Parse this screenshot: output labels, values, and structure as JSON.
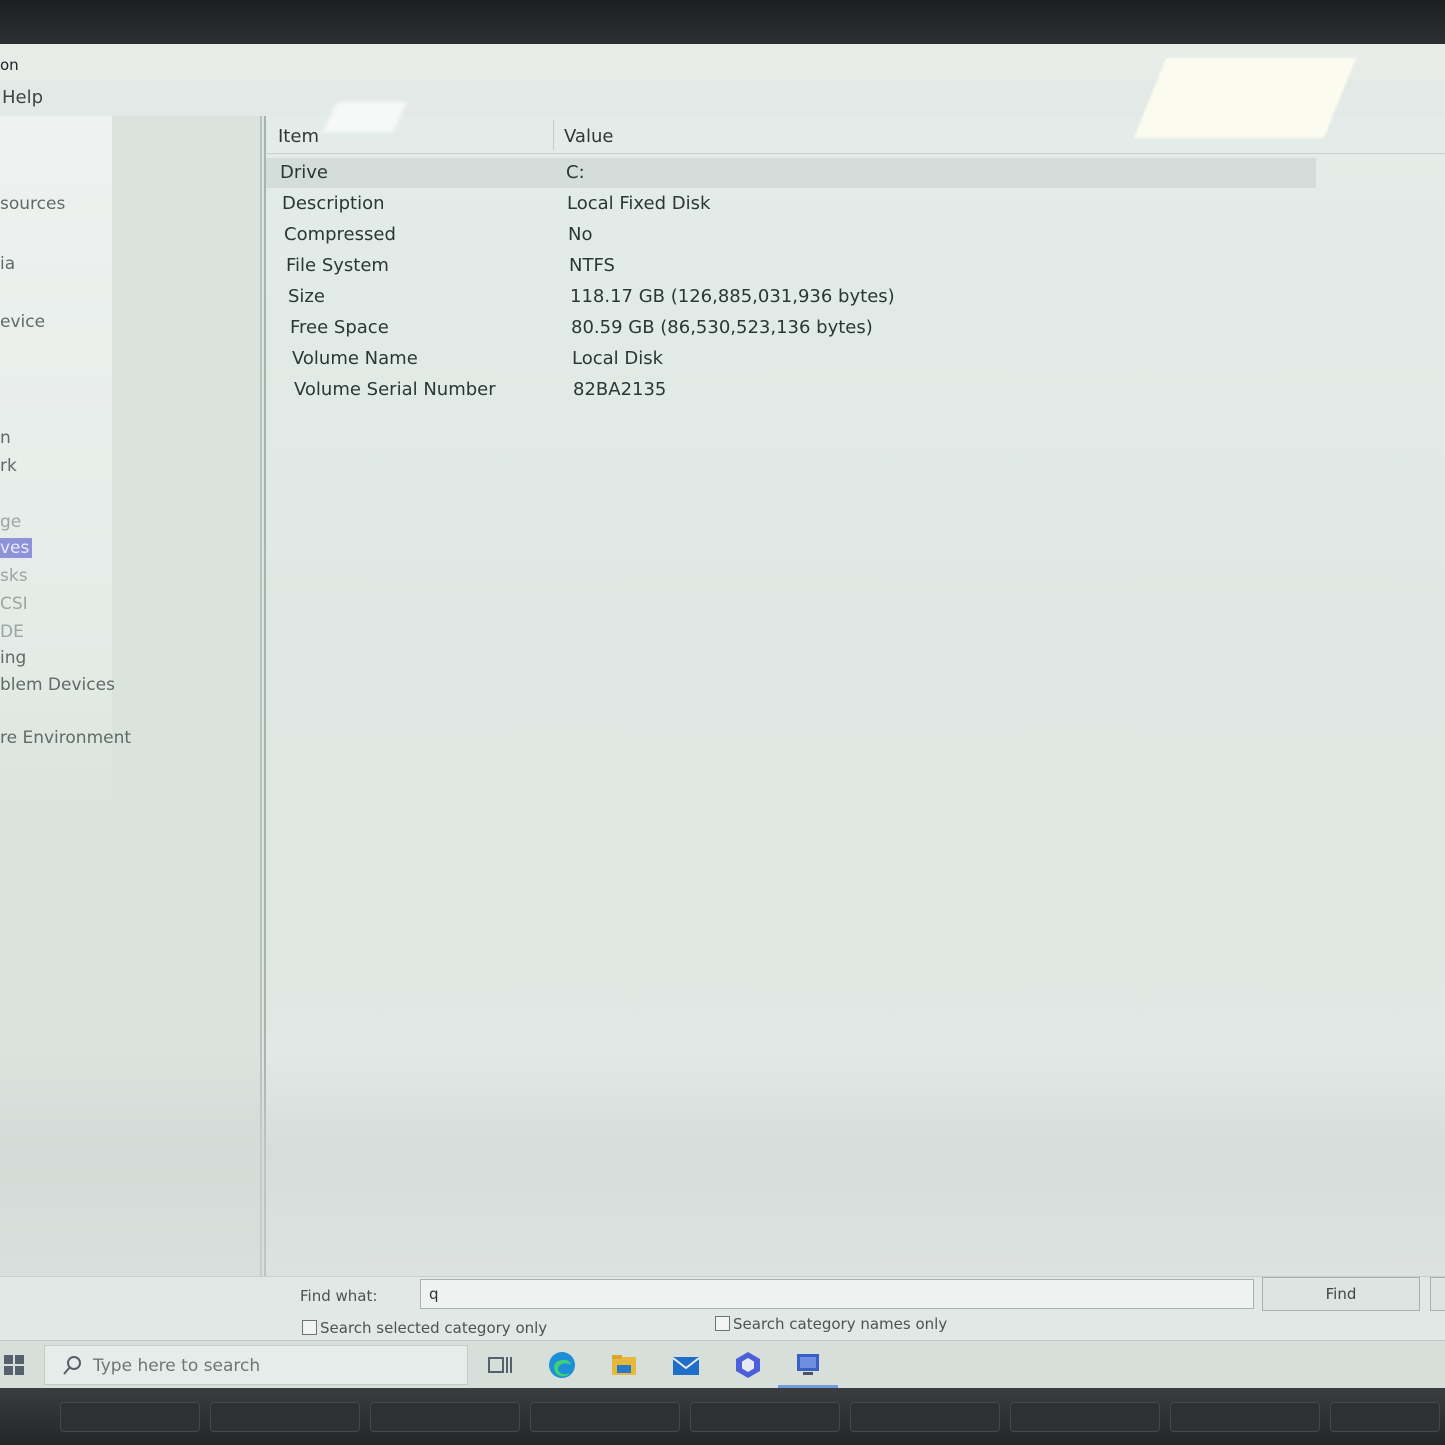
{
  "window": {
    "title_fragment": "on",
    "menu_help": "Help"
  },
  "tree": {
    "items": [
      {
        "label": "sources",
        "state": "normal"
      },
      {
        "label": "ia",
        "state": "normal"
      },
      {
        "label": "evice",
        "state": "normal"
      },
      {
        "label": "n",
        "state": "normal"
      },
      {
        "label": "rk",
        "state": "normal"
      },
      {
        "label": "ge",
        "state": "dim"
      },
      {
        "label": "ves",
        "state": "selected"
      },
      {
        "label": "sks",
        "state": "dim"
      },
      {
        "label": "CSI",
        "state": "dim"
      },
      {
        "label": "DE",
        "state": "dim"
      },
      {
        "label": "ing",
        "state": "normal"
      },
      {
        "label": "blem Devices",
        "state": "normal"
      },
      {
        "label": "re Environment",
        "state": "normal"
      }
    ]
  },
  "detail": {
    "columns": [
      "Item",
      "Value"
    ],
    "rows": [
      {
        "item": "Drive",
        "value": "C:"
      },
      {
        "item": "Description",
        "value": "Local Fixed Disk"
      },
      {
        "item": "Compressed",
        "value": "No"
      },
      {
        "item": "File System",
        "value": "NTFS"
      },
      {
        "item": "Size",
        "value": "118.17 GB (126,885,031,936 bytes)"
      },
      {
        "item": "Free Space",
        "value": "80.59 GB (86,530,523,136 bytes)"
      },
      {
        "item": "Volume Name",
        "value": "Local Disk"
      },
      {
        "item": "Volume Serial Number",
        "value": "82BA2135"
      }
    ]
  },
  "findbar": {
    "label": "Find what:",
    "value": "q",
    "find_button": "Find",
    "search_selected": "Search selected category only",
    "search_names": "Search category names only"
  },
  "taskbar": {
    "search_placeholder": "Type here to search",
    "apps": [
      "task-view-icon",
      "edge-icon",
      "file-explorer-icon",
      "mail-icon",
      "office-icon",
      "system-information-icon"
    ]
  },
  "colors": {
    "selection": "#8e92d8",
    "taskbar_active": "#6e9ed8"
  }
}
